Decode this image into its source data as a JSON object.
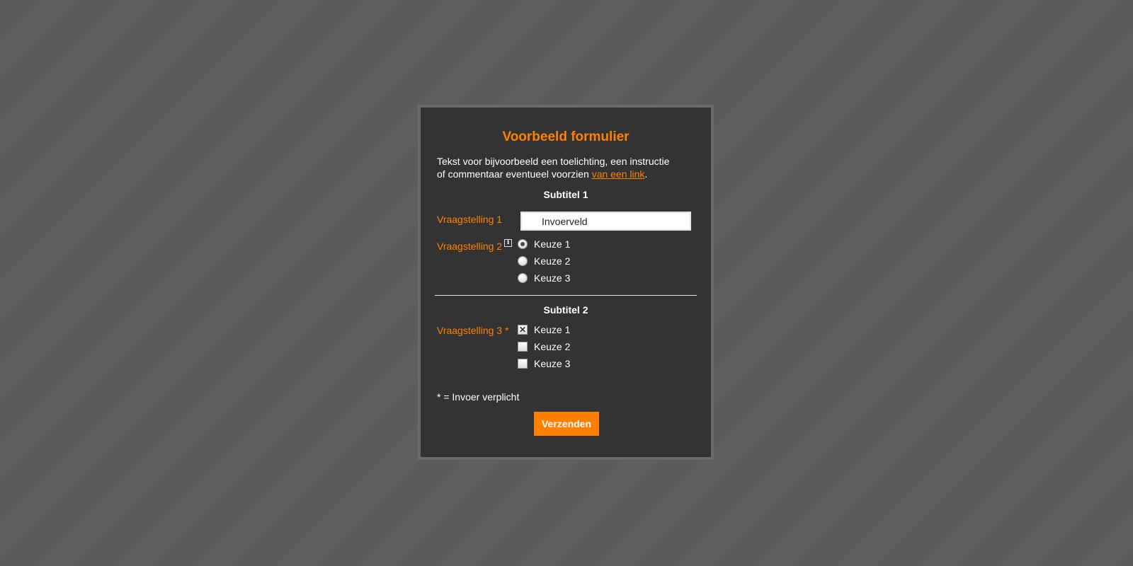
{
  "form": {
    "title": "Voorbeeld formulier",
    "intro_line1": "Tekst voor bijvoorbeeld een toelichting, een instructie",
    "intro_line2": "of commentaar eventueel voorzien ",
    "intro_link": "van een link",
    "intro_end": ".",
    "section1": {
      "subtitle": "Subtitel 1",
      "question1": {
        "label": "Vraagstelling 1",
        "value": "Invoerveld"
      },
      "question2": {
        "label": "Vraagstelling 2",
        "info_icon": "i",
        "options": [
          {
            "label": "Keuze 1",
            "checked": true
          },
          {
            "label": "Keuze 2",
            "checked": false
          },
          {
            "label": "Keuze 3",
            "checked": false
          }
        ]
      }
    },
    "section2": {
      "subtitle": "Subtitel 2",
      "question3": {
        "label": "Vraagstelling 3 *",
        "options": [
          {
            "label": "Keuze 1",
            "checked": true
          },
          {
            "label": "Keuze 2",
            "checked": false
          },
          {
            "label": "Keuze 3",
            "checked": false
          }
        ]
      }
    },
    "footnote": "* = Invoer verplicht",
    "submit_label": "Verzenden"
  },
  "colors": {
    "accent": "#ff8000",
    "panel": "#333333",
    "background": "#5b5b5b"
  }
}
